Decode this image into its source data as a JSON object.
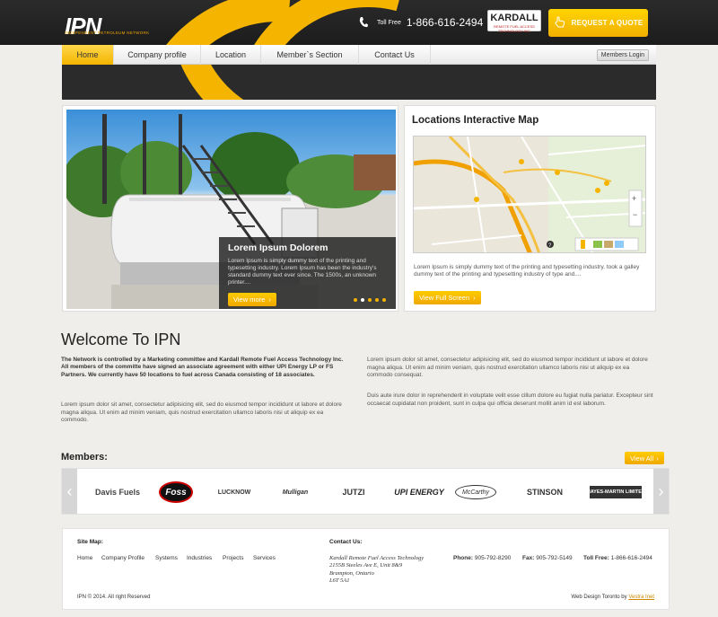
{
  "header": {
    "logo_text_a": "I",
    "logo_text_b": "PN",
    "logo_subtitle": "INDEPENDENT PETROLEUM NETWORK",
    "toll_free_label": "Toll Free",
    "phone_number": "1-866-616-2494",
    "partner_logo_title": "KARDALL",
    "partner_logo_subtitle": "REMOTE FUEL ACCESS TECHNOLOGY INC",
    "quote_button": "REQUEST A QUOTE"
  },
  "nav": {
    "items": [
      {
        "label": "Home",
        "active": true
      },
      {
        "label": "Company profile",
        "active": false
      },
      {
        "label": "Location",
        "active": false
      },
      {
        "label": "Member`s Section",
        "active": false
      },
      {
        "label": "Contact Us",
        "active": false
      }
    ],
    "members_login": "Members Login"
  },
  "slider": {
    "caption_title": "Lorem Ipsum Dolorem",
    "caption_text": "Lorem Ipsum is simply dummy text of the printing and typesetting industry. Lorem Ipsum has been the industry's standard dummy text ever since. The 1500s, an unknown printer....",
    "view_more": "View more",
    "dot_count": 5,
    "active_dot": 1
  },
  "map": {
    "title": "Locations Interactive Map",
    "text": "Lorem Ipsum is simply dummy text of the printing and typesetting industry. took a galley dummy text of the printing and typesetting industry of type and....",
    "button": "View Full Screen",
    "help_glyph": "?"
  },
  "welcome": {
    "title": "Welcome To IPN",
    "bold_paragraph": "The Network is controlled by a Marketing committee and Kardall Remote Fuel Access Technology Inc.  All members of the committe have signed an associate agreement with either UPI Energy LP or FS Partners.  We currently have 50 locations to fuel across Canada consisting of 18 associates.",
    "paragraph2": "Lorem ipsum dolor sit amet, consectetur adipisicing elit, sed do eiusmod tempor incididunt ut labore et dolore magna aliqua. Ut enim ad minim veniam, quis nostrud exercitation ullamco laboris nisi ut aliquip ex ea commodo.",
    "paragraph3": "Lorem ipsum dolor sit amet, consectetur adipisicing elit, sed do eiusmod tempor incididunt ut labore et dolore magna aliqua. Ut enim ad minim veniam, quis nostrud exercitation ullamco laboris nisi ut aliquip ex ea commodo consequat.",
    "paragraph4": "Duis aute irure dolor in reprehenderit in voluptate velit esse cillum dolore eu fugiat nulla pariatur. Excepteur sint occaecat cupidatat non proident, sunt in culpa qui officia deserunt mollit anim id est laborum."
  },
  "members": {
    "title": "Members:",
    "view_all": "View All",
    "logos": [
      {
        "name": "Davis Fuels"
      },
      {
        "name": "Foss"
      },
      {
        "name": "LUCKNOW"
      },
      {
        "name": "Mulligan"
      },
      {
        "name": "JUTZI"
      },
      {
        "name": "UPI ENERGY"
      },
      {
        "name": "McCarthy"
      },
      {
        "name": "STINSON"
      },
      {
        "name": "MAYES-MARTIN LIMITED"
      }
    ]
  },
  "footer": {
    "sitemap_title": "Site Map:",
    "sitemap_links": [
      "Home",
      "Company Profile",
      "Systems",
      "Industries",
      "Projects",
      "Services"
    ],
    "contact_title": "Contact Us:",
    "address_lines": [
      "Kardall Remote Fuel Access Technology",
      "2155B Steeles Ave E, Unit 8&9",
      "Brampton, Ontario",
      "L6T 5A1"
    ],
    "phone_label": "Phone:",
    "phone": "905-792-8290",
    "fax_label": "Fax:",
    "fax": "905-792-5149",
    "tollfree_label": "Toll Free:",
    "tollfree": "1-866-616-2494",
    "copyright": "IPN © 2014. All right Reserved",
    "credit_text": "Web Design Toronto by",
    "credit_link": "Vestra Inet"
  },
  "colors": {
    "accent": "#f4b400",
    "header_bg": "#222222",
    "page_bg": "#efeeea"
  }
}
